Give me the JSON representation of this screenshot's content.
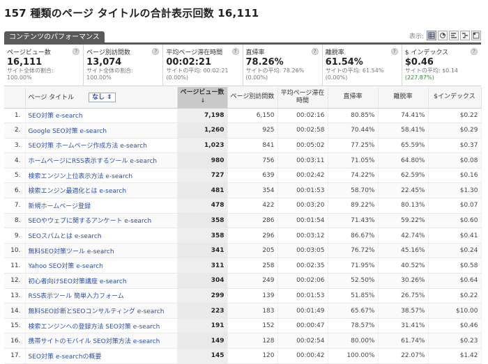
{
  "headline": "157 種類のページ タイトルの合計表示回数 16,111",
  "tab_label": "コンテンツのパフォーマンス",
  "view_label": "表示:",
  "summary": [
    {
      "name": "ページビュー数",
      "value": "16,111",
      "sub1": "サイト全体の割合:",
      "sub2": "100.00%",
      "sub2_green": false
    },
    {
      "name": "ページ別訪問数",
      "value": "13,074",
      "sub1": "サイト全体の割合:",
      "sub2": "100.00%",
      "sub2_green": false
    },
    {
      "name": "平均ページ滞在時間",
      "value": "00:02:21",
      "sub1": "サイトの平均: 00:02:21",
      "sub2": "(0.00%)",
      "sub2_green": false
    },
    {
      "name": "直帰率",
      "value": "78.26%",
      "sub1": "サイトの平均: 78.26%",
      "sub2": "(0.00%)",
      "sub2_green": false
    },
    {
      "name": "離脱率",
      "value": "61.54%",
      "sub1": "サイトの平均: 61.54%",
      "sub2": "(0.00%)",
      "sub2_green": false
    },
    {
      "name": "$ インデックス",
      "value": "$0.46",
      "sub1": "サイトの平均: $0.14",
      "sub2": "(227.87%)",
      "sub2_green": true
    }
  ],
  "columns": {
    "title": "ページ タイトル",
    "dim_select": "なし",
    "pageviews": "ページビュー数",
    "unique": "ページ別訪問数",
    "time": "平均ページ滞在時間",
    "bounce": "直帰率",
    "exit": "離脱率",
    "index": "$インデックス"
  },
  "rows": [
    {
      "n": "1.",
      "title": "SEO対策 e-search",
      "pv": "7,198",
      "uv": "6,150",
      "time": "00:02:16",
      "bounce": "80.85%",
      "exit": "74.41%",
      "idx": "$0.22"
    },
    {
      "n": "2.",
      "title": "Google SEO対策 e-search",
      "pv": "1,260",
      "uv": "925",
      "time": "00:02:58",
      "bounce": "70.44%",
      "exit": "58.41%",
      "idx": "$0.29"
    },
    {
      "n": "3.",
      "title": "SEO対策 ホームページ作成方法 e-search",
      "pv": "1,023",
      "uv": "841",
      "time": "00:05:02",
      "bounce": "77.25%",
      "exit": "65.59%",
      "idx": "$0.37"
    },
    {
      "n": "4.",
      "title": "ホームページにRSS表示するツール e-search",
      "pv": "980",
      "uv": "756",
      "time": "00:03:11",
      "bounce": "71.05%",
      "exit": "64.80%",
      "idx": "$0.08"
    },
    {
      "n": "5.",
      "title": "検索エンジン上位表示方法 e-search",
      "pv": "727",
      "uv": "639",
      "time": "00:02:42",
      "bounce": "74.22%",
      "exit": "62.59%",
      "idx": "$0.16"
    },
    {
      "n": "6.",
      "title": "検索エンジン最適化とは e-search",
      "pv": "481",
      "uv": "354",
      "time": "00:01:53",
      "bounce": "58.70%",
      "exit": "22.45%",
      "idx": "$1.30"
    },
    {
      "n": "7.",
      "title": "新規ホームページ登録",
      "pv": "478",
      "uv": "422",
      "time": "00:03:20",
      "bounce": "89.22%",
      "exit": "80.13%",
      "idx": "$0.07"
    },
    {
      "n": "8.",
      "title": "SEOやウェブに関するアンケート e-search",
      "pv": "358",
      "uv": "286",
      "time": "00:01:54",
      "bounce": "71.43%",
      "exit": "59.22%",
      "idx": "$0.60"
    },
    {
      "n": "9.",
      "title": "SEOスパムとは e-search",
      "pv": "358",
      "uv": "296",
      "time": "00:03:12",
      "bounce": "86.67%",
      "exit": "42.74%",
      "idx": "$0.41"
    },
    {
      "n": "10.",
      "title": "無料SEO対策ツール e-search",
      "pv": "341",
      "uv": "205",
      "time": "00:03:05",
      "bounce": "76.72%",
      "exit": "45.16%",
      "idx": "$0.24"
    },
    {
      "n": "11.",
      "title": "Yahoo SEO対策 e-search",
      "pv": "311",
      "uv": "258",
      "time": "00:02:35",
      "bounce": "71.95%",
      "exit": "40.52%",
      "idx": "$0.58"
    },
    {
      "n": "12.",
      "title": "初心者向けSEO対策講座 e-search",
      "pv": "304",
      "uv": "249",
      "time": "00:02:06",
      "bounce": "52.50%",
      "exit": "30.26%",
      "idx": "$0.64"
    },
    {
      "n": "13.",
      "title": "RSS表示ツール 簡単入力フォーム",
      "pv": "299",
      "uv": "139",
      "time": "00:01:53",
      "bounce": "51.85%",
      "exit": "26.75%",
      "idx": "$0.22"
    },
    {
      "n": "14.",
      "title": "無料SEO診断とSEOコンサルティング e-search",
      "pv": "223",
      "uv": "183",
      "time": "00:01:49",
      "bounce": "65.67%",
      "exit": "38.57%",
      "idx": "$10.00"
    },
    {
      "n": "15.",
      "title": "検索エンジンへの登録方法 SEO対策 e-search",
      "pv": "191",
      "uv": "152",
      "time": "00:00:47",
      "bounce": "78.57%",
      "exit": "31.41%",
      "idx": "$0.46"
    },
    {
      "n": "16.",
      "title": "携帯サイトのモバイル SEO対策方法 e-search",
      "pv": "149",
      "uv": "128",
      "time": "00:02:54",
      "bounce": "80.00%",
      "exit": "61.74%",
      "idx": "$0.23"
    },
    {
      "n": "17.",
      "title": "SEO対策 e-searchの概要",
      "pv": "145",
      "uv": "120",
      "time": "00:00:42",
      "bounce": "100.00%",
      "exit": "22.07%",
      "idx": "$1.42"
    }
  ]
}
